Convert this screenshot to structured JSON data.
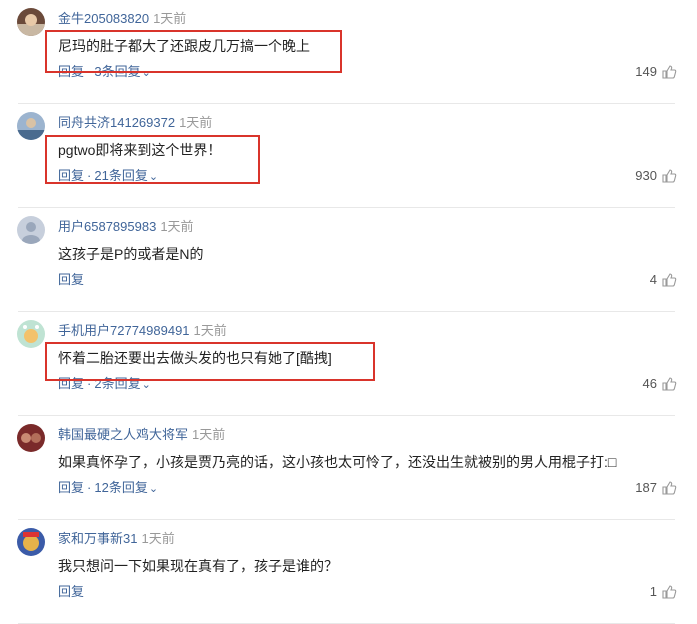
{
  "comments": [
    {
      "username": "金牛205083820",
      "time": "1天前",
      "text": "尼玛的肚子都大了还跟皮几万搞一个晚上",
      "reply_label": "回复",
      "reply_count": "3条回复",
      "likes": "149"
    },
    {
      "username": "同舟共济141269372",
      "time": "1天前",
      "text": "pgtwo即将来到这个世界！",
      "reply_label": "回复",
      "reply_count": "21条回复",
      "likes": "930"
    },
    {
      "username": "用户6587895983",
      "time": "1天前",
      "text": "这孩子是P的或者是N的",
      "reply_label": "回复",
      "reply_count": "",
      "likes": "4"
    },
    {
      "username": "手机用户72774989491",
      "time": "1天前",
      "text": "怀着二胎还要出去做头发的也只有她了[酷拽]",
      "reply_label": "回复",
      "reply_count": "2条回复",
      "likes": "46"
    },
    {
      "username": "韩国最硬之人鸡大将军",
      "time": "1天前",
      "text": "如果真怀孕了，小孩是贾乃亮的话，这小孩也太可怜了，还没出生就被别的男人用棍子打:□",
      "reply_label": "回复",
      "reply_count": "12条回复",
      "likes": "187"
    },
    {
      "username": "家和万事新31",
      "time": "1天前",
      "text": "我只想问一下如果现在真有了，孩子是谁的？",
      "reply_label": "回复",
      "reply_count": "",
      "likes": "1"
    }
  ],
  "icons": {
    "like": "thumbs-up-icon",
    "expand": "chevron-down-icon"
  },
  "colors": {
    "username": "#406599",
    "highlight_box": "#d9342b",
    "divider": "#e8e8e8"
  }
}
